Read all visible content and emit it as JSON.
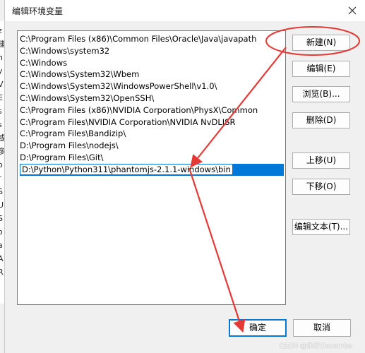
{
  "dialog": {
    "title": "编辑环境变量"
  },
  "background_fragments": [
    "z",
    "建",
    "n",
    "y",
    "V",
    "E",
    "s",
    "s",
    "或",
    "多",
    "o",
    "r",
    "S",
    "U",
    "S",
    "o",
    "a",
    "A",
    "R"
  ],
  "path_list": {
    "items": [
      "C:\\Program Files (x86)\\Common Files\\Oracle\\Java\\javapath",
      "C:\\Windows\\system32",
      "C:\\Windows",
      "C:\\Windows\\System32\\Wbem",
      "C:\\Windows\\System32\\WindowsPowerShell\\v1.0\\",
      "C:\\Windows\\System32\\OpenSSH\\",
      "C:\\Program Files (x86)\\NVIDIA Corporation\\PhysX\\Common",
      "C:\\Program Files\\NVIDIA Corporation\\NVIDIA NvDLISR",
      "C:\\Program Files\\Bandizip\\",
      "D:\\Program Files\\nodejs\\",
      "D:\\Program Files\\Git\\"
    ],
    "editing_value": "D:\\Python\\Python311\\phantomjs-2.1.1-windows\\bin"
  },
  "buttons": {
    "new": "新建(N)",
    "edit": "编辑(E)",
    "browse": "浏览(B)...",
    "delete": "删除(D)",
    "move_up": "上移(U)",
    "move_down": "下移(O)",
    "edit_text": "编辑文本(T)...",
    "ok": "确定",
    "cancel": "取消"
  },
  "annotation": {
    "color": "#e53935"
  },
  "watermark": "CSDN @米仔Decembe"
}
